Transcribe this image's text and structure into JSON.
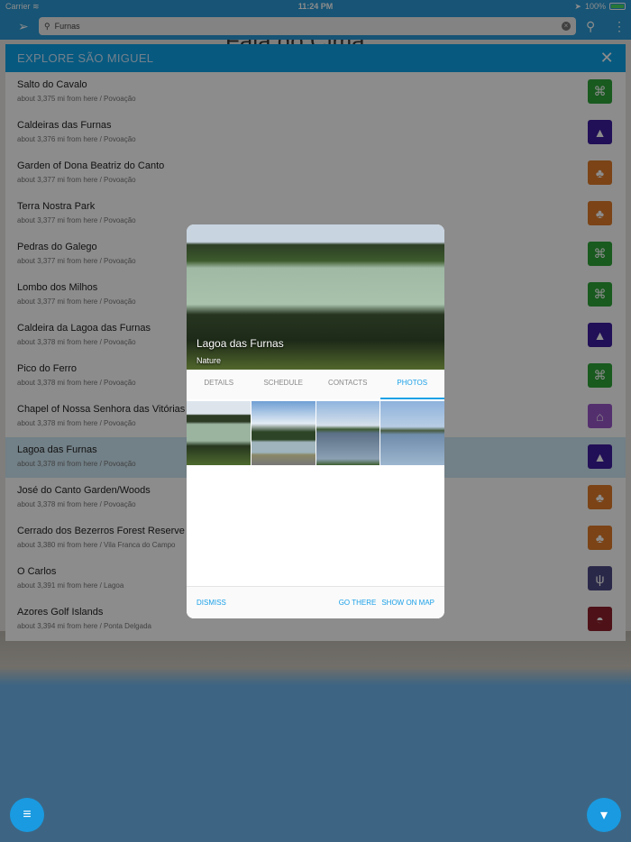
{
  "status": {
    "carrier": "Carrier",
    "time": "11:24 PM",
    "battery": "100%"
  },
  "search": {
    "value": "Furnas"
  },
  "map": {
    "label": "Fajã do Cima"
  },
  "panel": {
    "title": "EXPLORE SÃO MIGUEL",
    "items": [
      {
        "name": "Salto do Cavalo",
        "sub": "about 3,375 mi from here / Povoação",
        "icon": "binoculars-icon",
        "color": "#2fa43a"
      },
      {
        "name": "Caldeiras das Furnas",
        "sub": "about 3,376 mi from here / Povoação",
        "icon": "nature-icon",
        "color": "#3d1c9e"
      },
      {
        "name": "Garden of Dona Beatriz do Canto",
        "sub": "about 3,377 mi from here / Povoação",
        "icon": "park-icon",
        "color": "#e07a28"
      },
      {
        "name": "Terra Nostra Park",
        "sub": "about 3,377 mi from here / Povoação",
        "icon": "park-icon",
        "color": "#e07a28"
      },
      {
        "name": "Pedras do Galego",
        "sub": "about 3,377 mi from here / Povoação",
        "icon": "binoculars-icon",
        "color": "#2fa43a"
      },
      {
        "name": "Lombo dos Milhos",
        "sub": "about 3,377 mi from here / Povoação",
        "icon": "binoculars-icon",
        "color": "#2fa43a"
      },
      {
        "name": "Caldeira da Lagoa das Furnas",
        "sub": "about 3,378 mi from here / Povoação",
        "icon": "nature-icon",
        "color": "#3d1c9e"
      },
      {
        "name": "Pico do Ferro",
        "sub": "about 3,378 mi from here / Povoação",
        "icon": "binoculars-icon",
        "color": "#2fa43a"
      },
      {
        "name": "Chapel of Nossa Senhora das Vitórias",
        "sub": "about 3,378 mi from here / Povoação",
        "icon": "monument-icon",
        "color": "#9a56c8"
      },
      {
        "name": "Lagoa das Furnas",
        "sub": "about 3,378 mi from here / Povoação",
        "icon": "nature-icon",
        "color": "#3d1c9e",
        "selected": true
      },
      {
        "name": "José do Canto Garden/Woods",
        "sub": "about 3,378 mi from here / Povoação",
        "icon": "park-icon",
        "color": "#e07a28"
      },
      {
        "name": "Cerrado dos Bezerros Forest Reserve",
        "sub": "about 3,380 mi from here / Vila Franca do Campo",
        "icon": "park-icon",
        "color": "#e07a28"
      },
      {
        "name": "O Carlos",
        "sub": "about 3,391 mi from here / Lagoa",
        "icon": "restaurant-icon",
        "color": "#4d4a85"
      },
      {
        "name": "Azores Golf Islands",
        "sub": "about 3,394 mi from here / Ponta Delgada",
        "icon": "golf-icon",
        "color": "#8e1f2a"
      }
    ]
  },
  "modal": {
    "title": "Lagoa das Furnas",
    "category": "Nature",
    "tabs": [
      "DETAILS",
      "SCHEDULE",
      "CONTACTS",
      "PHOTOS"
    ],
    "active_tab": 3,
    "dismiss": "DISMISS",
    "go_there": "GO THERE",
    "show_on_map": "SHOW ON MAP"
  }
}
